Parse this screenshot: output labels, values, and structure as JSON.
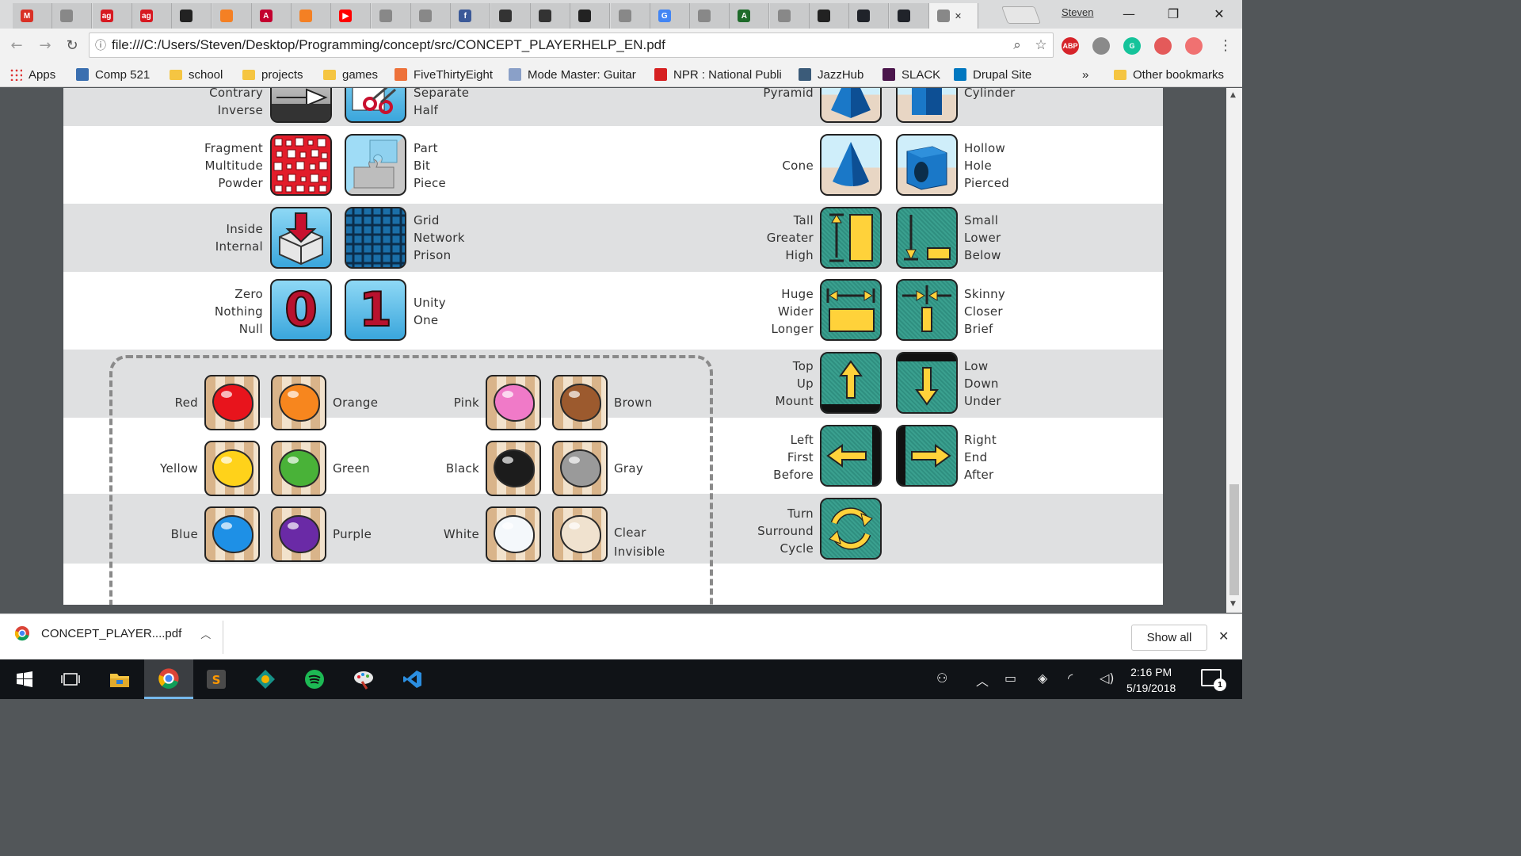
{
  "browser": {
    "tabs": [
      {
        "icon": "gmail-icon",
        "label": "M",
        "color": "#d93025"
      },
      {
        "icon": "doc-icon",
        "label": "",
        "color": "#888888"
      },
      {
        "icon": "ag-icon",
        "label": "ag",
        "color": "#d71921"
      },
      {
        "icon": "ag-icon",
        "label": "ag",
        "color": "#d71921"
      },
      {
        "icon": "github-icon",
        "label": "",
        "color": "#222222"
      },
      {
        "icon": "stackoverflow-icon",
        "label": "",
        "color": "#f48024"
      },
      {
        "icon": "angular-icon",
        "label": "A",
        "color": "#c3002f"
      },
      {
        "icon": "stackoverflow-icon",
        "label": "",
        "color": "#f48024"
      },
      {
        "icon": "youtube-icon",
        "label": "▶",
        "color": "#ff0000"
      },
      {
        "icon": "doc-icon",
        "label": "",
        "color": "#888888"
      },
      {
        "icon": "doc-icon",
        "label": "",
        "color": "#888888"
      },
      {
        "icon": "facebook-icon",
        "label": "f",
        "color": "#3b5998"
      },
      {
        "icon": "aperture-icon",
        "label": "",
        "color": "#333333"
      },
      {
        "icon": "aperture-icon",
        "label": "",
        "color": "#333333"
      },
      {
        "icon": "github-icon",
        "label": "",
        "color": "#222222"
      },
      {
        "icon": "doc-icon",
        "label": "",
        "color": "#888888"
      },
      {
        "icon": "google-icon",
        "label": "G",
        "color": "#4285f4"
      },
      {
        "icon": "doc-icon",
        "label": "",
        "color": "#888888"
      },
      {
        "icon": "terminal-icon",
        "label": "A",
        "color": "#1e6b2a"
      },
      {
        "icon": "doc-icon",
        "label": "",
        "color": "#888888"
      },
      {
        "icon": "github-icon",
        "label": "",
        "color": "#222222"
      },
      {
        "icon": "react-icon",
        "label": "",
        "color": "#20232a"
      },
      {
        "icon": "react-icon",
        "label": "",
        "color": "#20232a"
      },
      {
        "icon": "doc-icon",
        "label": "",
        "color": "#888888"
      }
    ],
    "profile_name": "Steven",
    "url": "file:///C:/Users/Steven/Desktop/Programming/concept/src/CONCEPT_PLAYERHELP_EN.pdf",
    "extensions": [
      {
        "name": "adblock-icon",
        "label": "ABP",
        "color": "#d6232a"
      },
      {
        "name": "extension-icon",
        "label": "",
        "color": "#8a8a8a"
      },
      {
        "name": "grammarly-icon",
        "label": "G",
        "color": "#15c39a"
      },
      {
        "name": "save-icon",
        "label": "",
        "color": "#e45a5a"
      },
      {
        "name": "cast-icon",
        "label": "",
        "color": "#f07171"
      }
    ],
    "bookmarks": [
      {
        "name": "apps",
        "label": "Apps",
        "kind": "grid",
        "color": "#d33"
      },
      {
        "name": "comp-521",
        "label": "Comp 521",
        "kind": "icon",
        "color": "#3a6fb0"
      },
      {
        "name": "school",
        "label": "school",
        "kind": "folder"
      },
      {
        "name": "projects",
        "label": "projects",
        "kind": "folder"
      },
      {
        "name": "games",
        "label": "games",
        "kind": "folder"
      },
      {
        "name": "fivethirtyeight",
        "label": "FiveThirtyEight",
        "kind": "icon",
        "color": "#ed713a"
      },
      {
        "name": "mode-master",
        "label": "Mode Master: Guitar",
        "kind": "icon",
        "color": "#8aa0c8"
      },
      {
        "name": "npr",
        "label": "NPR : National Publi",
        "kind": "icon",
        "color": "#d62021"
      },
      {
        "name": "jazzhub",
        "label": "JazzHub",
        "kind": "icon",
        "color": "#3b5b79"
      },
      {
        "name": "slack",
        "label": "SLACK",
        "kind": "icon",
        "color": "#4a154b"
      },
      {
        "name": "drupal",
        "label": "Drupal Site",
        "kind": "icon",
        "color": "#0077c0"
      }
    ],
    "bookmarks_overflow": "»",
    "other_bookmarks": "Other bookmarks"
  },
  "pdf": {
    "rows": [
      {
        "left_words": [
          "Contrary",
          "Inverse"
        ],
        "right_words": [
          "Separate",
          "Half"
        ],
        "far_left_words": [
          "Pyramid"
        ],
        "far_right_words": [
          "Cylinder"
        ]
      },
      {
        "left_words": [
          "Fragment",
          "Multitude",
          "Powder"
        ],
        "right_words": [
          "Part",
          "Bit",
          "Piece"
        ],
        "far_left_words": [
          "Cone"
        ],
        "far_right_words": [
          "Hollow",
          "Hole",
          "Pierced"
        ]
      },
      {
        "left_words": [
          "Inside",
          "Internal"
        ],
        "right_words": [
          "Grid",
          "Network",
          "Prison"
        ],
        "far_left_words": [
          "Tall",
          "Greater",
          "High"
        ],
        "far_right_words": [
          "Small",
          "Lower",
          "Below"
        ]
      },
      {
        "left_words": [
          "Zero",
          "Nothing",
          "Null"
        ],
        "right_words": [
          "Unity",
          "One"
        ],
        "far_left_words": [
          "Huge",
          "Wider",
          "Longer"
        ],
        "far_right_words": [
          "Skinny",
          "Closer",
          "Brief"
        ]
      },
      {
        "far_left_words": [
          "Top",
          "Up",
          "Mount"
        ],
        "far_right_words": [
          "Low",
          "Down",
          "Under"
        ]
      },
      {
        "far_left_words": [
          "Left",
          "First",
          "Before"
        ],
        "far_right_words": [
          "Right",
          "End",
          "After"
        ]
      },
      {
        "far_left_words": [
          "Turn",
          "Surround",
          "Cycle"
        ]
      }
    ],
    "zero_digit": "0",
    "one_digit": "1",
    "colors": [
      {
        "label": "Red",
        "hex": "#e8141c"
      },
      {
        "label": "Orange",
        "hex": "#f7861e"
      },
      {
        "label": "Pink",
        "hex": "#f07ac8"
      },
      {
        "label": "Brown",
        "hex": "#9c5a2e"
      },
      {
        "label": "Yellow",
        "hex": "#ffd21a"
      },
      {
        "label": "Green",
        "hex": "#49b238"
      },
      {
        "label": "Black",
        "hex": "#1c1c1c"
      },
      {
        "label": "Gray",
        "hex": "#9a9a9a"
      },
      {
        "label": "Blue",
        "hex": "#1e90e6"
      },
      {
        "label": "Purple",
        "hex": "#6a2aa6"
      },
      {
        "label": "White",
        "hex": "#f4f8fb"
      },
      {
        "label": "Clear",
        "hex": "#f0e2cf"
      }
    ],
    "clear_second_word": "Invisible"
  },
  "downloads": {
    "file_name": "CONCEPT_PLAYER....pdf",
    "show_all": "Show all"
  },
  "taskbar": {
    "time": "2:16 PM",
    "date": "5/19/2018",
    "notification_count": "1"
  }
}
